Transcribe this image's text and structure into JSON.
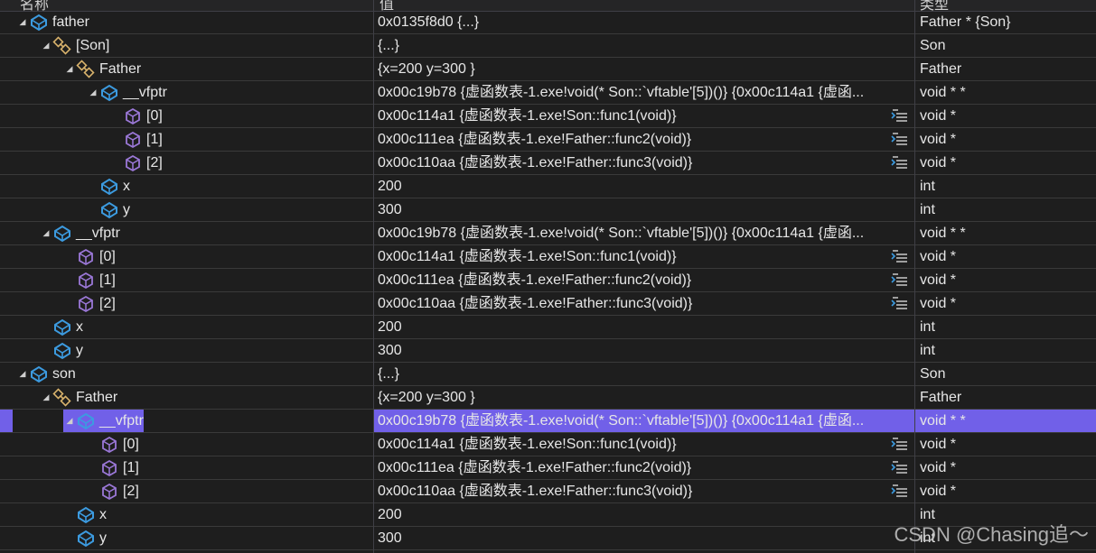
{
  "header": {
    "col_name": "名称",
    "col_value": "值",
    "col_type": "类型"
  },
  "rows": [
    {
      "name": "father",
      "value": "0x0135f8d0 {...}",
      "type": "Father * {Son}",
      "icon": "field-icon",
      "expander": "expanded",
      "level": 0
    },
    {
      "name": "[Son]",
      "value": "{...}",
      "type": "Son",
      "icon": "base-class-icon",
      "expander": "expanded",
      "level": 1
    },
    {
      "name": "Father",
      "value": "{x=200 y=300 }",
      "type": "Father",
      "icon": "base-class-icon",
      "expander": "expanded",
      "level": 2
    },
    {
      "name": "__vfptr",
      "value": "0x00c19b78 {虚函数表-1.exe!void(* Son::`vftable'[5])()} {0x00c114a1 {虚函...",
      "type": "void * *",
      "icon": "field-icon",
      "expander": "expanded",
      "level": 3
    },
    {
      "name": "[0]",
      "value": "0x00c114a1 {虚函数表-1.exe!Son::func1(void)}",
      "type": "void *",
      "icon": "member-icon",
      "expander": "none",
      "level": 4,
      "visualizer": true
    },
    {
      "name": "[1]",
      "value": "0x00c111ea {虚函数表-1.exe!Father::func2(void)}",
      "type": "void *",
      "icon": "member-icon",
      "expander": "none",
      "level": 4,
      "visualizer": true
    },
    {
      "name": "[2]",
      "value": "0x00c110aa {虚函数表-1.exe!Father::func3(void)}",
      "type": "void *",
      "icon": "member-icon",
      "expander": "none",
      "level": 4,
      "visualizer": true
    },
    {
      "name": "x",
      "value": "200",
      "type": "int",
      "icon": "field-icon",
      "expander": "none",
      "level": 3
    },
    {
      "name": "y",
      "value": "300",
      "type": "int",
      "icon": "field-icon",
      "expander": "none",
      "level": 3
    },
    {
      "name": "__vfptr",
      "value": "0x00c19b78 {虚函数表-1.exe!void(* Son::`vftable'[5])()} {0x00c114a1 {虚函...",
      "type": "void * *",
      "icon": "field-icon",
      "expander": "expanded",
      "level": 1
    },
    {
      "name": "[0]",
      "value": "0x00c114a1 {虚函数表-1.exe!Son::func1(void)}",
      "type": "void *",
      "icon": "member-icon",
      "expander": "none",
      "level": 2,
      "visualizer": true
    },
    {
      "name": "[1]",
      "value": "0x00c111ea {虚函数表-1.exe!Father::func2(void)}",
      "type": "void *",
      "icon": "member-icon",
      "expander": "none",
      "level": 2,
      "visualizer": true
    },
    {
      "name": "[2]",
      "value": "0x00c110aa {虚函数表-1.exe!Father::func3(void)}",
      "type": "void *",
      "icon": "member-icon",
      "expander": "none",
      "level": 2,
      "visualizer": true
    },
    {
      "name": "x",
      "value": "200",
      "type": "int",
      "icon": "field-icon",
      "expander": "none",
      "level": 1
    },
    {
      "name": "y",
      "value": "300",
      "type": "int",
      "icon": "field-icon",
      "expander": "none",
      "level": 1
    },
    {
      "name": "son",
      "value": "{...}",
      "type": "Son",
      "icon": "field-icon",
      "expander": "expanded",
      "level": 0
    },
    {
      "name": "Father",
      "value": "{x=200 y=300 }",
      "type": "Father",
      "icon": "base-class-icon",
      "expander": "expanded",
      "level": 1
    },
    {
      "name": "__vfptr",
      "value": "0x00c19b78 {虚函数表-1.exe!void(* Son::`vftable'[5])()} {0x00c114a1 {虚函...",
      "type": "void * *",
      "icon": "field-icon",
      "expander": "expanded",
      "level": 2,
      "selected": true
    },
    {
      "name": "[0]",
      "value": "0x00c114a1 {虚函数表-1.exe!Son::func1(void)}",
      "type": "void *",
      "icon": "member-icon",
      "expander": "none",
      "level": 3,
      "visualizer": true
    },
    {
      "name": "[1]",
      "value": "0x00c111ea {虚函数表-1.exe!Father::func2(void)}",
      "type": "void *",
      "icon": "member-icon",
      "expander": "none",
      "level": 3,
      "visualizer": true
    },
    {
      "name": "[2]",
      "value": "0x00c110aa {虚函数表-1.exe!Father::func3(void)}",
      "type": "void *",
      "icon": "member-icon",
      "expander": "none",
      "level": 3,
      "visualizer": true
    },
    {
      "name": "x",
      "value": "200",
      "type": "int",
      "icon": "field-icon",
      "expander": "none",
      "level": 2
    },
    {
      "name": "y",
      "value": "300",
      "type": "int",
      "icon": "field-icon",
      "expander": "none",
      "level": 2
    }
  ],
  "watermark": "CSDN @Chasing追～",
  "colors": {
    "background": "#1e1e1e",
    "selection": "#7160e8",
    "field_icon": "#3c9be0",
    "member_icon": "#9b78d8",
    "base_class_icon": "#d9b36c",
    "grid_line": "#3a3a3a"
  }
}
